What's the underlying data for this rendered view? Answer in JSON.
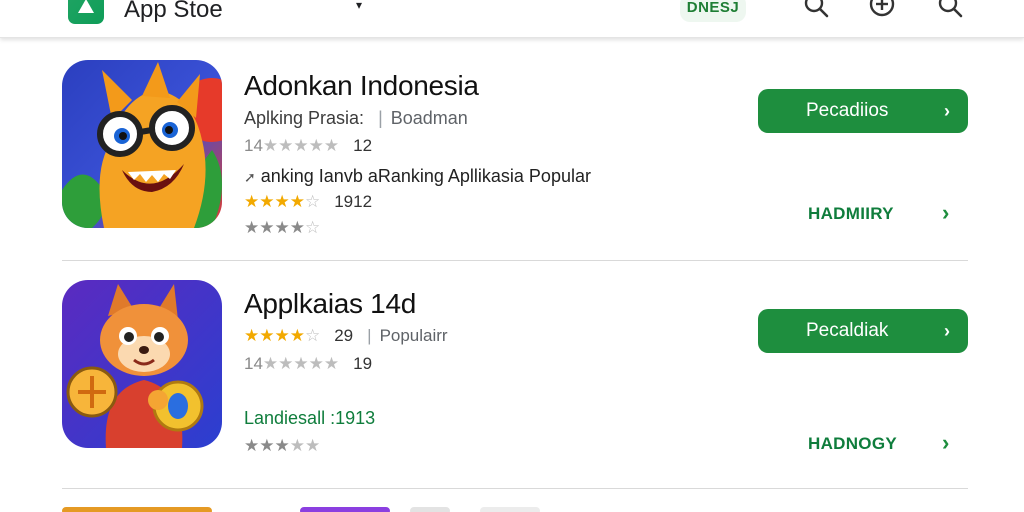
{
  "header": {
    "title": "App Stoe",
    "caret": "▾",
    "tag": "DNESJ",
    "icons": [
      "search-icon",
      "add-circle-icon",
      "search-icon"
    ]
  },
  "colors": {
    "accent": "#1e8e3e",
    "star": "#f2a900"
  },
  "apps": [
    {
      "title": "Adonkan Indonesia",
      "subtitle": "Aplking Prasia:",
      "subtitle_extra": "Boadman",
      "rating_small_prefix": "14",
      "rating_small_count": "12",
      "ranking_text": "anking Ianvb aRanking  Apllikasia Popular",
      "rating_count": "1912",
      "button_label": "Pecadiios",
      "link_label": "HADMIIRY",
      "icon": "dragon-mascot-icon"
    },
    {
      "title": "Applkaias 14d",
      "rating_count": "29",
      "subtitle_extra": "Populairr",
      "rating_small_prefix": "14",
      "rating_small_count": "19",
      "green_text": "Landiesall :1913",
      "button_label": "Pecaldiak",
      "link_label": "HADNOGY",
      "icon": "fox-mascot-icon"
    }
  ]
}
